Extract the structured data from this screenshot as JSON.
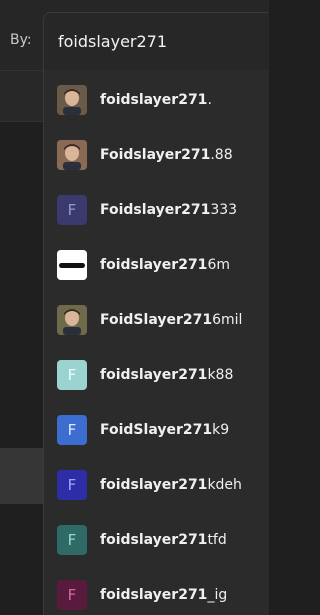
{
  "filter": {
    "by_label": "By:",
    "query": "foidslayer271"
  },
  "colors": {
    "panel": "#2b2b2b",
    "background": "#1f1f1f",
    "text": "#f0f0f0"
  },
  "options": [
    {
      "match": "foidslayer271",
      "rest": ".",
      "avatar": {
        "kind": "photo",
        "bg": "#6b5a4a"
      }
    },
    {
      "match": "Foidslayer271",
      "rest": ".88",
      "avatar": {
        "kind": "photo",
        "bg": "#8a6a55"
      }
    },
    {
      "match": "Foidslayer271",
      "rest": "333",
      "avatar": {
        "kind": "letter",
        "letter": "F",
        "bg": "#3b3a6e",
        "fg": "#9a99cc"
      }
    },
    {
      "match": "foidslayer271",
      "rest": "6m",
      "avatar": {
        "kind": "image",
        "bg": "#ffffff"
      }
    },
    {
      "match": "FoidSlayer271",
      "rest": "6mil",
      "avatar": {
        "kind": "photo",
        "bg": "#6e6a4a"
      }
    },
    {
      "match": "foidslayer271",
      "rest": "k88",
      "avatar": {
        "kind": "letter",
        "letter": "F",
        "bg": "#9bd3d0",
        "fg": "#e8ffff"
      }
    },
    {
      "match": "FoidSlayer271",
      "rest": "k9",
      "avatar": {
        "kind": "letter",
        "letter": "F",
        "bg": "#3c6ed1",
        "fg": "#dfe9ff"
      }
    },
    {
      "match": "foidslayer271",
      "rest": "kdeh",
      "avatar": {
        "kind": "letter",
        "letter": "F",
        "bg": "#2e2da8",
        "fg": "#a5a4ff"
      }
    },
    {
      "match": "foidslayer271",
      "rest": "tfd",
      "avatar": {
        "kind": "letter",
        "letter": "F",
        "bg": "#2f6b66",
        "fg": "#9fd6d0"
      }
    },
    {
      "match": "foidslayer271",
      "rest": "_ig",
      "avatar": {
        "kind": "letter",
        "letter": "F",
        "bg": "#5a1a3e",
        "fg": "#d46aa3"
      }
    }
  ]
}
